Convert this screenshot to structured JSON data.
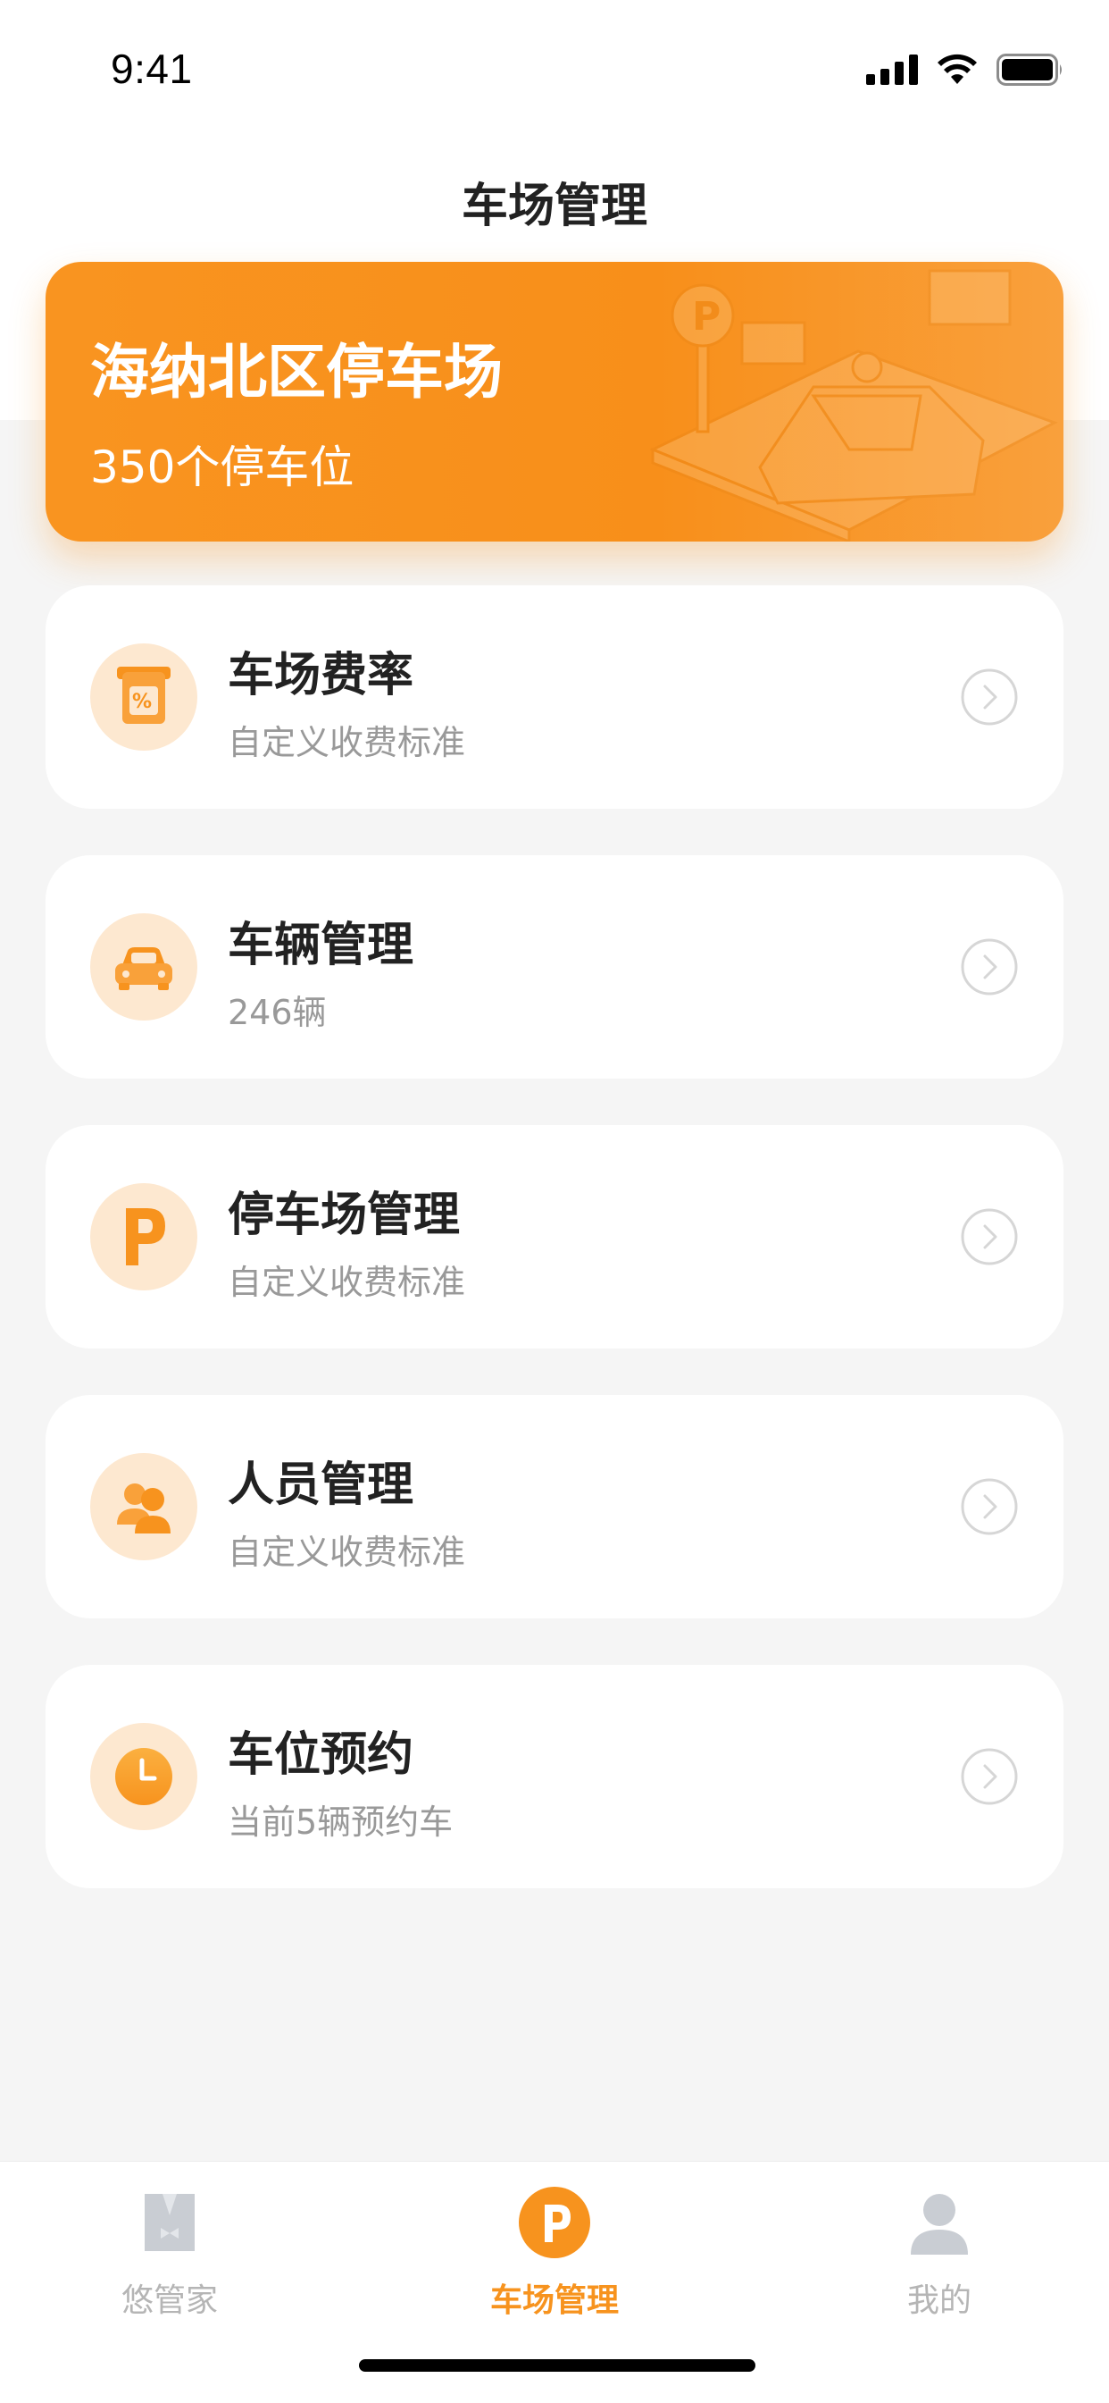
{
  "status_bar": {
    "time": "9:41"
  },
  "nav": {
    "title": "车场管理"
  },
  "lot": {
    "name": "海纳北区停车场",
    "capacity": "350个停车位"
  },
  "menu": [
    {
      "title": "车场费率",
      "subtitle": "自定义收费标准",
      "icon": "rate-percent-icon"
    },
    {
      "title": "车辆管理",
      "subtitle": "246辆",
      "icon": "car-icon"
    },
    {
      "title": "停车场管理",
      "subtitle": "自定义收费标准",
      "icon": "parking-p-icon"
    },
    {
      "title": "人员管理",
      "subtitle": "自定义收费标准",
      "icon": "people-icon"
    },
    {
      "title": "车位预约",
      "subtitle": "当前5辆预约车",
      "icon": "clock-icon"
    }
  ],
  "tabs": [
    {
      "label": "悠管家",
      "icon": "butler-icon",
      "active": false
    },
    {
      "label": "车场管理",
      "icon": "parking-tab-icon",
      "active": true
    },
    {
      "label": "我的",
      "icon": "profile-icon",
      "active": false
    }
  ],
  "colors": {
    "accent": "#F7931E",
    "icon_bg": "#FDE8D0",
    "background": "#F5F5F5"
  }
}
